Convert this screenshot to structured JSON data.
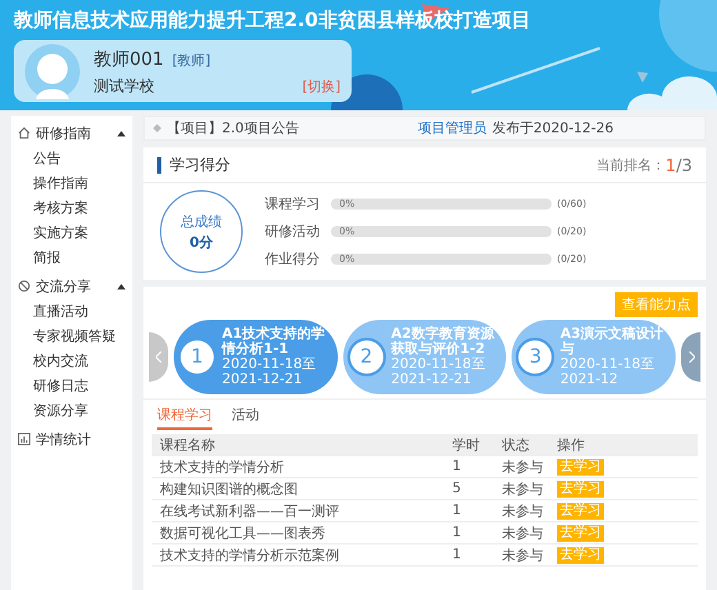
{
  "header": {
    "title": "教师信息技术应用能力提升工程2.0非贫困县样板校打造项目",
    "user": {
      "name": "教师001",
      "role": "[教师]",
      "school": "测试学校",
      "switch": "[切换]"
    }
  },
  "sidebar": [
    {
      "label": "研修指南",
      "kind": "guide",
      "expanded": true,
      "children": [
        {
          "label": "公告"
        },
        {
          "label": "操作指南"
        },
        {
          "label": "考核方案"
        },
        {
          "label": "实施方案"
        },
        {
          "label": "简报"
        }
      ]
    },
    {
      "label": "交流分享",
      "kind": "share",
      "expanded": true,
      "children": [
        {
          "label": "直播活动"
        },
        {
          "label": "专家视频答疑"
        },
        {
          "label": "校内交流"
        },
        {
          "label": "研修日志"
        },
        {
          "label": "资源分享"
        }
      ]
    },
    {
      "label": "学情统计",
      "kind": "stats"
    }
  ],
  "notice": {
    "title": "【项目】2.0项目公告",
    "author": "项目管理员",
    "published": "发布于2020-12-26"
  },
  "score": {
    "title": "学习得分",
    "rank_label": "当前排名：",
    "rank": "1",
    "rank_total": "/3",
    "total_label": "总成绩",
    "total_value": "0分",
    "bars": [
      {
        "label": "课程学习",
        "level": 0,
        "percent": "0%",
        "reading": "(0/60)"
      },
      {
        "label": "研修活动",
        "level": 0,
        "percent": "0%",
        "reading": "(0/20)"
      },
      {
        "label": "作业得分",
        "level": 0,
        "percent": "0%",
        "reading": "(0/20)"
      }
    ]
  },
  "abilities": {
    "button": "查看能力点",
    "steps": [
      {
        "number": "1",
        "title": "A1技术支持的学情分析1-1",
        "dates": "2020-11-18至2021-12-21",
        "selected": true
      },
      {
        "number": "2",
        "title": "A2数字教育资源获取与评价1-2",
        "dates": "2020-11-18至2021-12-21",
        "selected": false
      },
      {
        "number": "3",
        "title": "A3演示文稿设计与",
        "dates": "2020-11-18至2021-12",
        "selected": false
      }
    ],
    "tabs": [
      {
        "label": "课程学习",
        "selected": true
      },
      {
        "label": "活动",
        "selected": false
      }
    ],
    "table": {
      "columns": [
        "课程名称",
        "学时",
        "状态",
        "操作"
      ],
      "rows": [
        {
          "name": "技术支持的学情分析",
          "hours": "1",
          "status": "未参与",
          "action": "去学习"
        },
        {
          "name": "构建知识图谱的概念图",
          "hours": "5",
          "status": "未参与",
          "action": "去学习"
        },
        {
          "name": "在线考试新利器——百一测评",
          "hours": "1",
          "status": "未参与",
          "action": "去学习"
        },
        {
          "name": "数据可视化工具——图表秀",
          "hours": "1",
          "status": "未参与",
          "action": "去学习"
        },
        {
          "name": "技术支持的学情分析示范案例",
          "hours": "1",
          "status": "未参与",
          "action": "去学习"
        }
      ]
    }
  }
}
